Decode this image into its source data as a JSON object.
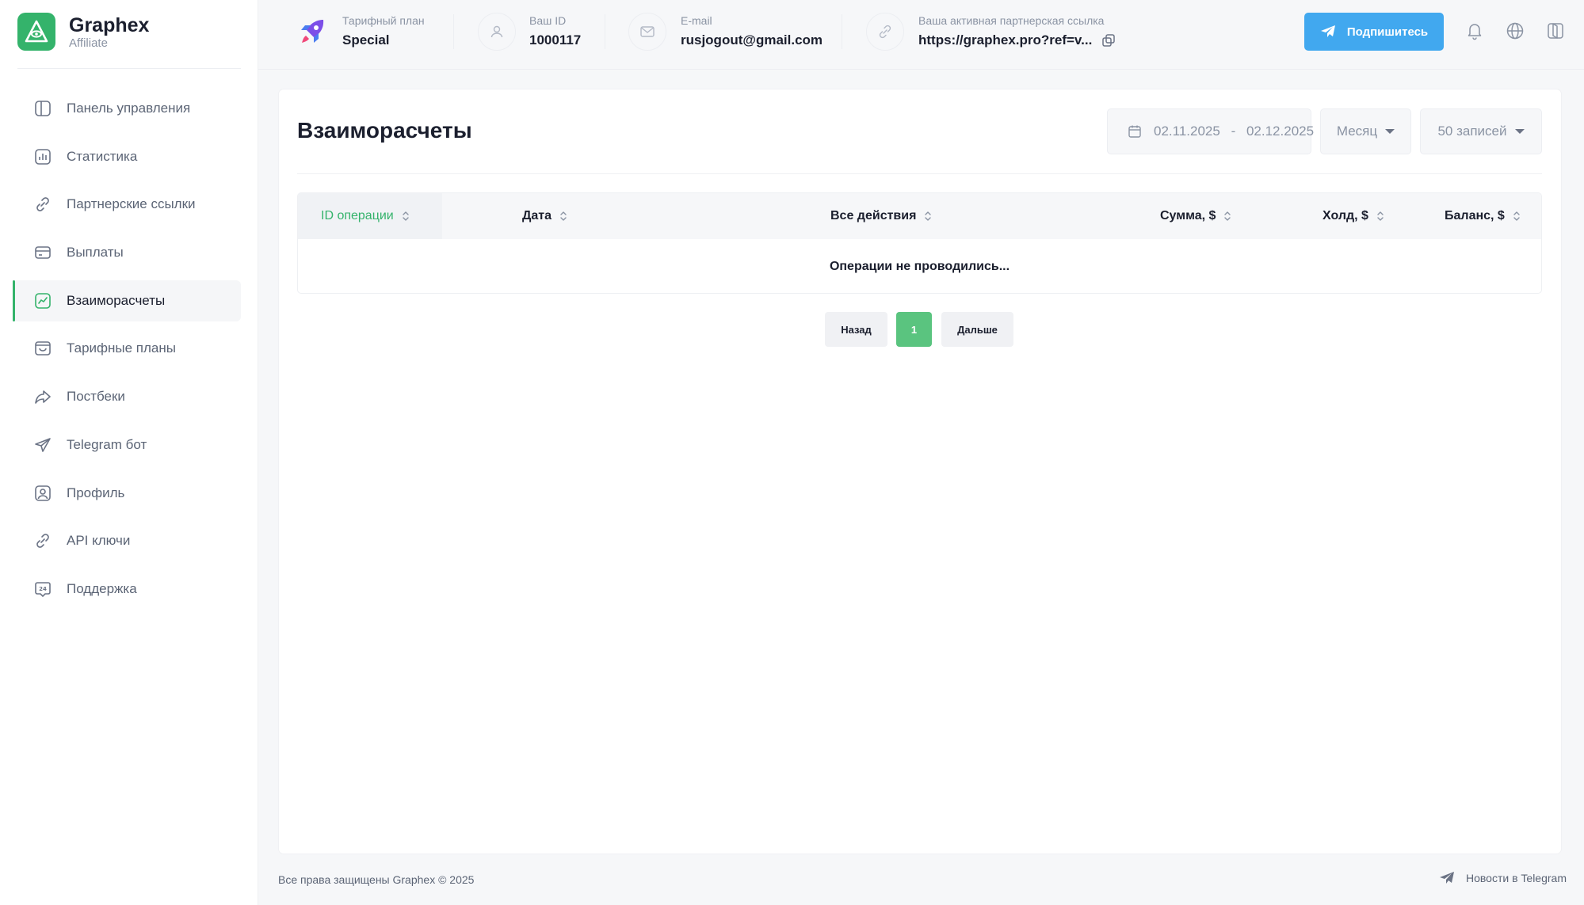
{
  "brand": {
    "name": "Graphex",
    "subtitle": "Affiliate"
  },
  "sidebar": {
    "items": [
      {
        "label": "Панель управления",
        "icon": "layout-panel-icon"
      },
      {
        "label": "Статистика",
        "icon": "stats-icon"
      },
      {
        "label": "Партнерские ссылки",
        "icon": "link-icon"
      },
      {
        "label": "Выплаты",
        "icon": "card-icon"
      },
      {
        "label": "Взаиморасчеты",
        "icon": "chart-trend-icon",
        "active": true
      },
      {
        "label": "Тарифные планы",
        "icon": "plans-icon"
      },
      {
        "label": "Постбеки",
        "icon": "postback-icon"
      },
      {
        "label": "Telegram бот",
        "icon": "telegram-icon"
      },
      {
        "label": "Профиль",
        "icon": "profile-icon"
      },
      {
        "label": "API ключи",
        "icon": "api-link-icon"
      },
      {
        "label": "Поддержка",
        "icon": "support-24-icon"
      }
    ]
  },
  "header": {
    "plan": {
      "caption": "Тарифный план",
      "value": "Special"
    },
    "user_id": {
      "caption": "Ваш ID",
      "value": "1000117"
    },
    "email": {
      "caption": "E-mail",
      "value": "rusjogout@gmail.com"
    },
    "ref_link": {
      "caption": "Ваша активная партнерская ссылка",
      "value": "https://graphex.pro?ref=v..."
    },
    "subscribe_label": "Подпишитесь"
  },
  "page": {
    "title": "Взаиморасчеты",
    "date_range": {
      "from": "02.11.2025",
      "separator": "-",
      "to": "02.12.2025"
    },
    "period_select": "Месяц",
    "records_select": "50 записей"
  },
  "table": {
    "columns": [
      "ID операции",
      "Дата",
      "Все действия",
      "Сумма, $",
      "Холд, $",
      "Баланс, $"
    ],
    "empty_message": "Операции не проводились..."
  },
  "pagination": {
    "prev": "Назад",
    "current": "1",
    "next": "Дальше"
  },
  "footer": {
    "copyright": "Все права защищены Graphex © 2025",
    "news_link": "Новости в Telegram"
  },
  "colors": {
    "accent": "#34b36b",
    "subscribe": "#41a8ef",
    "pagination_current": "#5ac47f"
  }
}
